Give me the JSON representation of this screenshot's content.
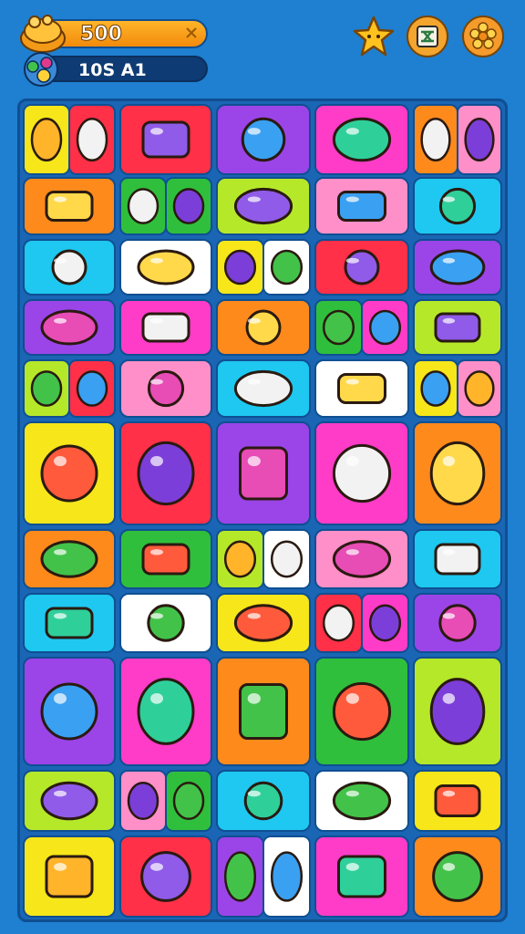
{
  "hud": {
    "coins": "500",
    "level": "10S A1",
    "colors": {
      "coin_bar": "#f7a21b",
      "level_bar": "#0e3b73",
      "board_bg": "#1a66b4"
    },
    "icons": [
      "coin-pile-icon",
      "level-badge-icon",
      "star-icon",
      "settings-card-icon",
      "flower-coin-icon"
    ]
  },
  "board": {
    "rows": 13,
    "cols": 5,
    "tile_colors": [
      "yellow",
      "pink",
      "orange",
      "red",
      "cyan",
      "green",
      "purple",
      "white",
      "lime",
      "magenta"
    ],
    "items": [
      "pill-capsule",
      "dice",
      "cup",
      "gear",
      "number-1",
      "number-2",
      "apple",
      "lemon",
      "blob",
      "leaf",
      "flower",
      "egg",
      "box",
      "plum",
      "radio",
      "pencil",
      "fish",
      "sandbag",
      "candy-bowl",
      "camera",
      "ice-cream",
      "crown",
      "gem",
      "tomato",
      "paintbrush",
      "phone",
      "cloud",
      "bean"
    ]
  }
}
